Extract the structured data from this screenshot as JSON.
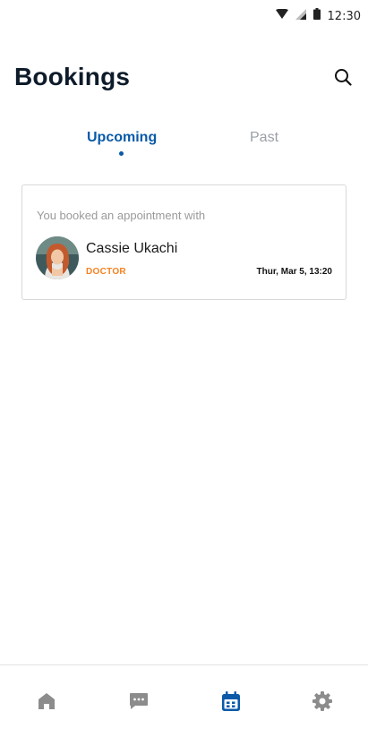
{
  "status_bar": {
    "time": "12:30",
    "icons": [
      "wifi-icon",
      "signal-icon",
      "battery-icon"
    ]
  },
  "header": {
    "title": "Bookings",
    "search_icon": "search-icon"
  },
  "tabs": [
    {
      "label": "Upcoming",
      "active": true
    },
    {
      "label": "Past",
      "active": false
    }
  ],
  "booking": {
    "intro": "You booked an appointment with",
    "name": "Cassie Ukachi",
    "role": "DOCTOR",
    "date": "Thur, Mar 5, 13:20"
  },
  "bottom_nav": [
    {
      "icon": "home-icon",
      "active": false
    },
    {
      "icon": "chat-icon",
      "active": false
    },
    {
      "icon": "calendar-icon",
      "active": true
    },
    {
      "icon": "settings-icon",
      "active": false
    }
  ],
  "colors": {
    "accent": "#0a5aa8",
    "role": "#f58220",
    "inactive_icon": "#8c8c8c"
  }
}
